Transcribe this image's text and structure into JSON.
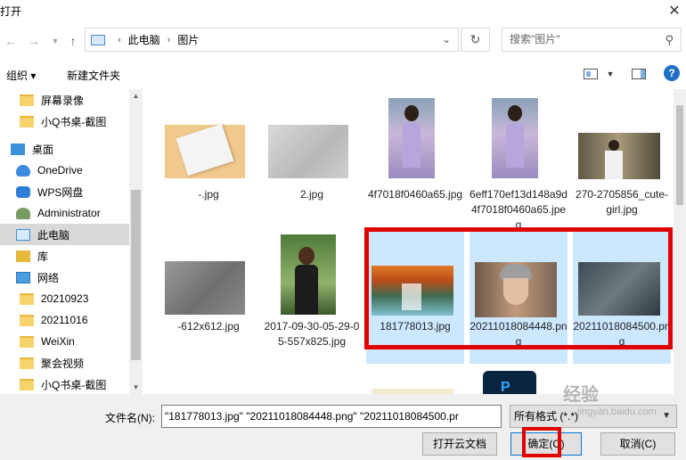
{
  "window": {
    "title": "打开",
    "close_glyph": "✕"
  },
  "address": {
    "crumbs": [
      "此电脑",
      "图片"
    ],
    "search_placeholder": "搜索\"图片\""
  },
  "toolbar": {
    "organize": "组织 ▾",
    "new_folder": "新建文件夹",
    "help": "?"
  },
  "sidebar": {
    "items": [
      {
        "label": "屏幕录像",
        "icon": "folder-icon"
      },
      {
        "label": "小Q书桌-截图",
        "icon": "folder-icon"
      },
      {
        "label": "桌面",
        "icon": "desktop-icon"
      },
      {
        "label": "OneDrive",
        "icon": "cloud-icon"
      },
      {
        "label": "WPS网盘",
        "icon": "wps-icon"
      },
      {
        "label": "Administrator",
        "icon": "user-icon"
      },
      {
        "label": "此电脑",
        "icon": "pc-icon",
        "selected": true
      },
      {
        "label": "库",
        "icon": "library-icon"
      },
      {
        "label": "网络",
        "icon": "network-icon"
      },
      {
        "label": "20210923",
        "icon": "folder-icon"
      },
      {
        "label": "20211016",
        "icon": "folder-icon"
      },
      {
        "label": "WeiXin",
        "icon": "folder-icon"
      },
      {
        "label": "聚会视频",
        "icon": "folder-icon"
      },
      {
        "label": "小Q书桌-截图",
        "icon": "folder-icon"
      }
    ]
  },
  "files": [
    {
      "name": "-.jpg"
    },
    {
      "name": "2.jpg"
    },
    {
      "name": "4f7018f0460a65.jpg"
    },
    {
      "name": "6eff170ef13d148a9d4f7018f0460a65.jpeg"
    },
    {
      "name": "270-2705856_cute-girl.jpg"
    },
    {
      "name": "-612x612.jpg"
    },
    {
      "name": "2017-09-30-05-29-05-557x825.jpg"
    },
    {
      "name": "181778013.jpg",
      "selected": true
    },
    {
      "name": "20211018084448.png",
      "selected": true
    },
    {
      "name": "20211018084500.png",
      "selected": true
    }
  ],
  "footer": {
    "filename_label": "文件名(N):",
    "filename_value": "\"181778013.jpg\" \"20211018084448.png\" \"20211018084500.pr",
    "filetype": "所有格式 (*.*)",
    "open_cloud": "打开云文档",
    "ok": "确定(O)",
    "cancel": "取消(C)"
  },
  "watermark": {
    "line1": "经验",
    "line2": "jingyan.baidu.com"
  },
  "colors": {
    "selection": "#cce8ff",
    "annotation": "#e00000",
    "accent": "#0078d7"
  }
}
